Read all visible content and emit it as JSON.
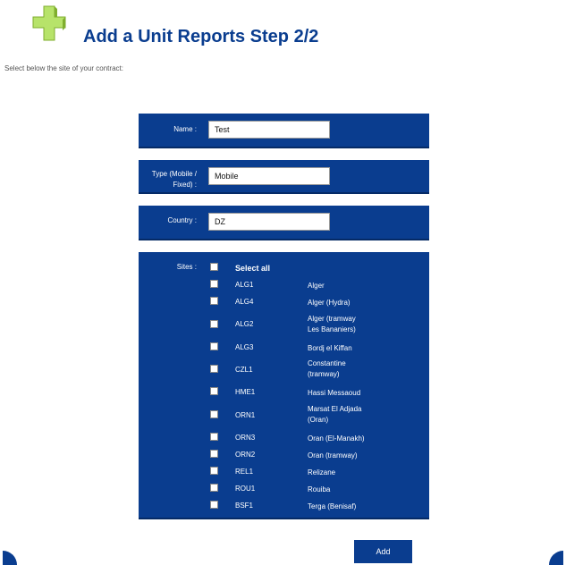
{
  "header": {
    "title": "Add a Unit Reports Step 2/2",
    "subtitle": "Select below the site of your contract:"
  },
  "form": {
    "name_label": "Name :",
    "name_value": "Test",
    "type_label_1": "Type (Mobile /",
    "type_label_2": "Fixed) :",
    "type_value": "Mobile",
    "country_label": "Country :",
    "country_value": "DZ",
    "sites_label": "Sites :",
    "select_all_label": "Select all",
    "sites": [
      {
        "code": "ALG1",
        "name1": "Alger",
        "name2": ""
      },
      {
        "code": "ALG4",
        "name1": "Alger (Hydra)",
        "name2": ""
      },
      {
        "code": "ALG2",
        "name1": "Alger (tramway",
        "name2": "Les Bananiers)"
      },
      {
        "code": "ALG3",
        "name1": "Bordj el Kiffan",
        "name2": ""
      },
      {
        "code": "CZL1",
        "name1": "Constantine",
        "name2": "(tramway)"
      },
      {
        "code": "HME1",
        "name1": "Hassi Messaoud",
        "name2": ""
      },
      {
        "code": "ORN1",
        "name1": "Marsat El Adjada",
        "name2": "(Oran)"
      },
      {
        "code": "ORN3",
        "name1": "Oran (El-Manakh)",
        "name2": ""
      },
      {
        "code": "ORN2",
        "name1": "Oran (tramway)",
        "name2": ""
      },
      {
        "code": "REL1",
        "name1": "Relizane",
        "name2": ""
      },
      {
        "code": "ROU1",
        "name1": "Rouiba",
        "name2": ""
      },
      {
        "code": "BSF1",
        "name1": "Terga (Benisaf)",
        "name2": ""
      }
    ],
    "add_label": "Add"
  },
  "colors": {
    "panel": "#0a3d8f",
    "title": "#0a3d8f",
    "icon": "#9bd04a"
  }
}
